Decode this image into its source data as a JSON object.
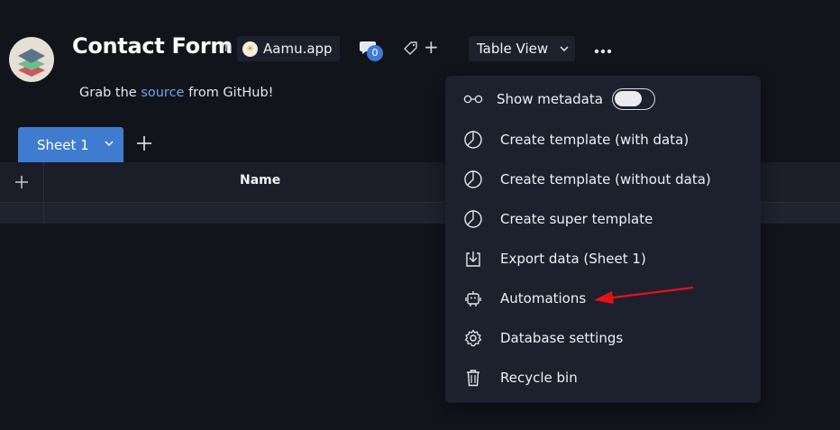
{
  "header": {
    "title": "Contact Form",
    "in_word": "in",
    "workspace": "Aamu.app",
    "comment_count": "0",
    "view_label": "Table View"
  },
  "description": {
    "prefix": "Grab the ",
    "link": "source",
    "suffix": " from GitHub!"
  },
  "sheets": [
    {
      "label": "Sheet 1"
    }
  ],
  "grid": {
    "columns": [
      "Name"
    ]
  },
  "menu": {
    "items": [
      {
        "label": "Show metadata",
        "icon": "glasses-icon",
        "toggle": false
      },
      {
        "label": "Create template (with data)",
        "icon": "pie-icon"
      },
      {
        "label": "Create template (without data)",
        "icon": "pie-icon"
      },
      {
        "label": "Create super template",
        "icon": "pie-icon"
      },
      {
        "label": "Export data (Sheet 1)",
        "icon": "download-icon"
      },
      {
        "label": "Automations",
        "icon": "robot-icon"
      },
      {
        "label": "Database settings",
        "icon": "gear-icon"
      },
      {
        "label": "Recycle bin",
        "icon": "trash-icon"
      }
    ]
  },
  "colors": {
    "background": "#12141c",
    "accent": "#3f7cd0",
    "link": "#6ea3f0",
    "annotation_arrow": "#e8101a"
  }
}
